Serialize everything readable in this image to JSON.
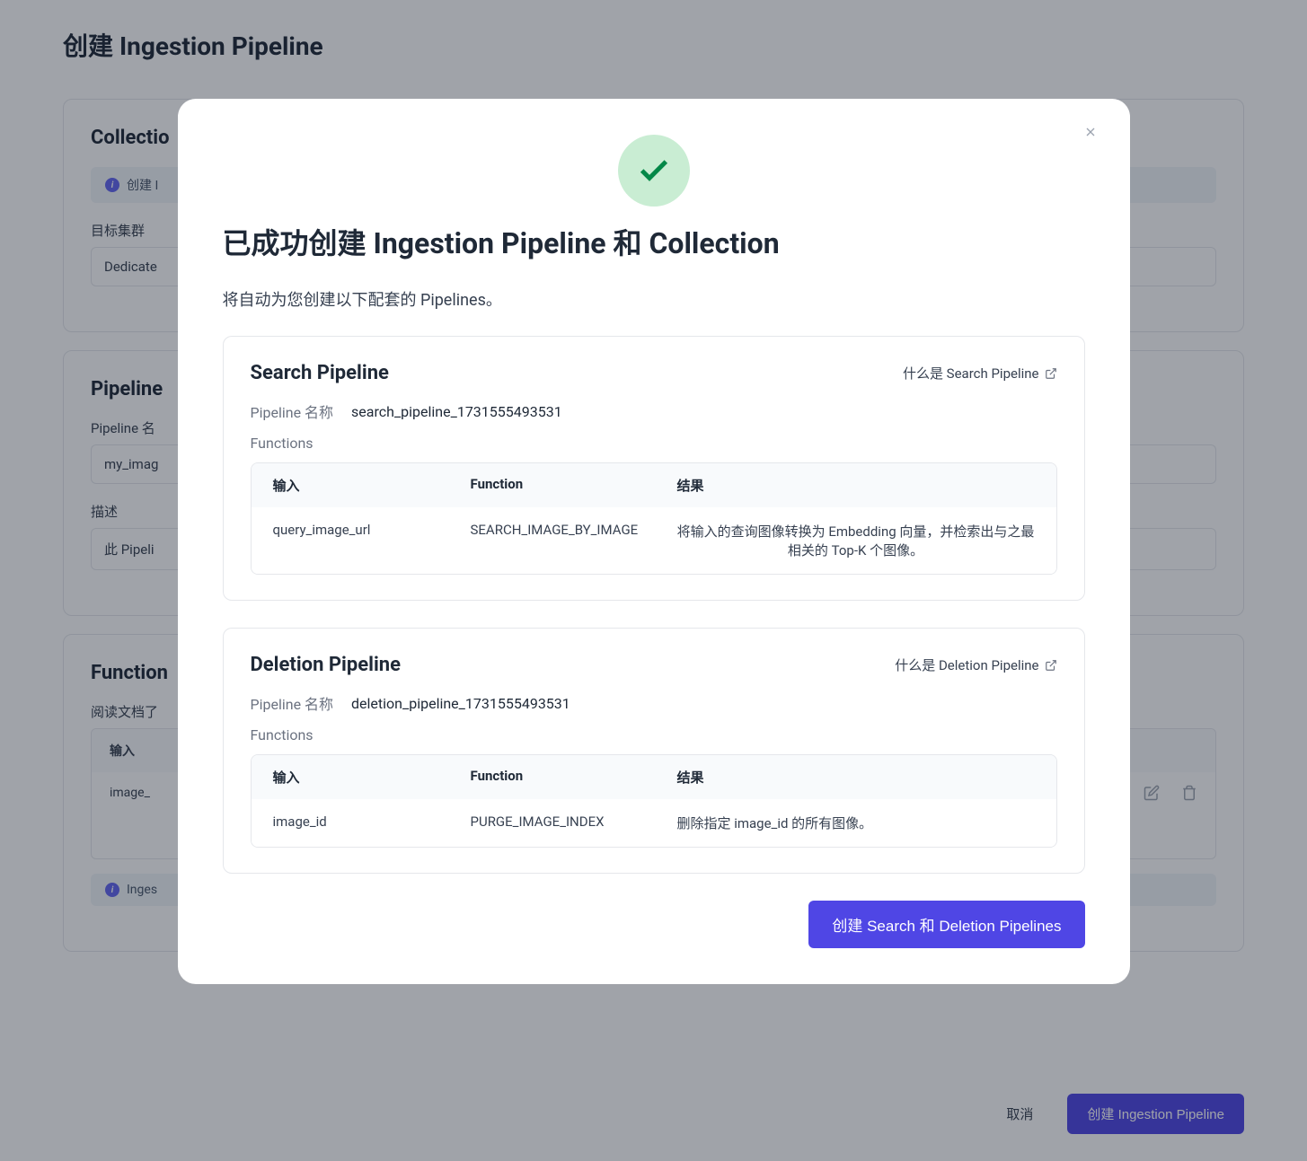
{
  "background": {
    "page_title": "创建 Ingestion Pipeline",
    "collection_section": {
      "title": "Collectio",
      "info_text": "创建 I",
      "target_cluster_label": "目标集群",
      "target_cluster_value": "Dedicate"
    },
    "pipeline_section": {
      "title": "Pipeline",
      "name_label": "Pipeline 名",
      "name_value": "my_imag",
      "desc_label": "描述",
      "desc_value": "此 Pipeli"
    },
    "functions_section": {
      "title": "Function",
      "read_docs": "阅读文档了",
      "table": {
        "header_input": "输入",
        "row_input": "image_"
      },
      "inges_text": "Inges"
    },
    "footer": {
      "cancel": "取消",
      "create": "创建 Ingestion Pipeline"
    }
  },
  "modal": {
    "title": "已成功创建 Ingestion Pipeline 和 Collection",
    "subtitle": "将自动为您创建以下配套的 Pipelines。",
    "search_pipeline": {
      "title": "Search Pipeline",
      "whatis": "什么是 Search Pipeline",
      "name_label": "Pipeline 名称",
      "name_value": "search_pipeline_1731555493531",
      "functions_label": "Functions",
      "table": {
        "header_input": "输入",
        "header_function": "Function",
        "header_result": "结果",
        "rows": [
          {
            "input": "query_image_url",
            "function": "SEARCH_IMAGE_BY_IMAGE",
            "result": "将输入的查询图像转换为 Embedding 向量，并检索出与之最相关的 Top-K 个图像。"
          }
        ]
      }
    },
    "deletion_pipeline": {
      "title": "Deletion Pipeline",
      "whatis": "什么是 Deletion Pipeline",
      "name_label": "Pipeline 名称",
      "name_value": "deletion_pipeline_1731555493531",
      "functions_label": "Functions",
      "table": {
        "header_input": "输入",
        "header_function": "Function",
        "header_result": "结果",
        "rows": [
          {
            "input": "image_id",
            "function": "PURGE_IMAGE_INDEX",
            "result": "删除指定 image_id 的所有图像。"
          }
        ]
      }
    },
    "create_button": "创建 Search 和 Deletion Pipelines"
  }
}
